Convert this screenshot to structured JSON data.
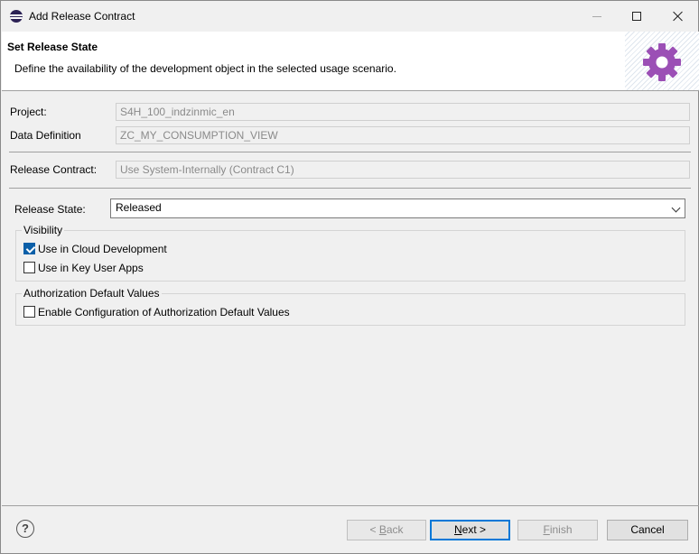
{
  "window": {
    "title": "Add Release Contract"
  },
  "banner": {
    "title": "Set Release State",
    "description": "Define the availability of the development object in the selected usage scenario."
  },
  "fields": {
    "project": {
      "label": "Project:",
      "value": "S4H_100_indzinmic_en"
    },
    "data_definition": {
      "label": "Data Definition",
      "value": "ZC_MY_CONSUMPTION_VIEW"
    },
    "release_contract": {
      "label": "Release Contract:",
      "value": "Use System-Internally (Contract C1)"
    },
    "release_state": {
      "label": "Release State:",
      "value": "Released"
    }
  },
  "visibility": {
    "legend": "Visibility",
    "options": [
      {
        "label": "Use in Cloud Development",
        "checked": true
      },
      {
        "label": "Use in Key User Apps",
        "checked": false
      }
    ]
  },
  "authorization": {
    "legend": "Authorization Default Values",
    "options": [
      {
        "label": "Enable Configuration of Authorization Default Values",
        "checked": false
      }
    ]
  },
  "buttons": {
    "back": {
      "mnemonic": "B",
      "rest": "ack",
      "prefix": "< "
    },
    "next": {
      "mnemonic": "N",
      "rest": "ext >"
    },
    "finish": {
      "mnemonic": "F",
      "rest": "inish"
    },
    "cancel": "Cancel"
  },
  "help_glyph": "?",
  "colors": {
    "accent": "#0078d7",
    "checkbox": "#0b5fa8",
    "gear": "#9b4fb5"
  }
}
